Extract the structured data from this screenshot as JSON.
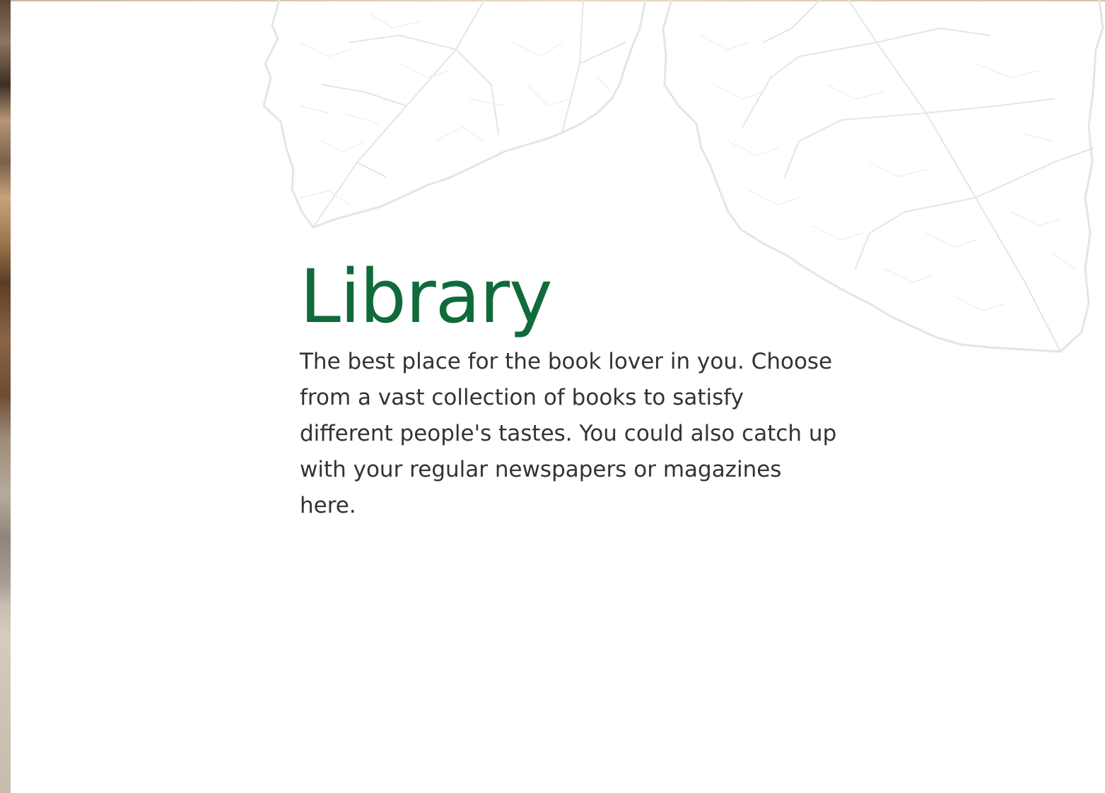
{
  "section": {
    "title": "Library",
    "description": "The best place for the book lover in you. Choose from a vast collection of books to satisfy different people's tastes. You could also catch up with your regular newspapers or magazines here."
  },
  "colors": {
    "title": "#0f6b3a",
    "text": "#333333",
    "leaf_outline": "#e5e5e5",
    "background": "#ffffff"
  },
  "decorations": [
    "leaf-outline-left",
    "leaf-outline-right"
  ]
}
